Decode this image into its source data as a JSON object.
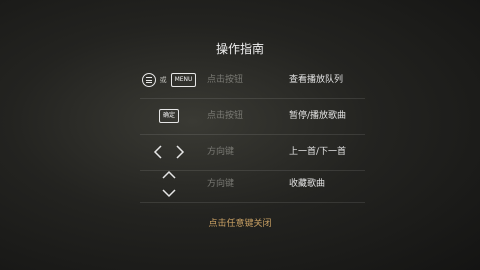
{
  "title": "操作指南",
  "rows": [
    {
      "or_text": "或",
      "menu_key": "MENU",
      "action": "点击按钮",
      "desc": "查看播放队列"
    },
    {
      "key": "确定",
      "action": "点击按钮",
      "desc": "暂停/播放歌曲"
    },
    {
      "action": "方向键",
      "desc": "上一首/下一首"
    },
    {
      "action": "方向键",
      "desc": "收藏歌曲"
    }
  ],
  "footer": "点击任意键关闭",
  "colors": {
    "accent": "#c9a063",
    "muted": "#7a7a74",
    "text": "#e4e4e4"
  },
  "icons": [
    "menu-circle-icon",
    "left-arrow-icon",
    "right-arrow-icon",
    "up-arrow-icon",
    "down-arrow-icon"
  ]
}
